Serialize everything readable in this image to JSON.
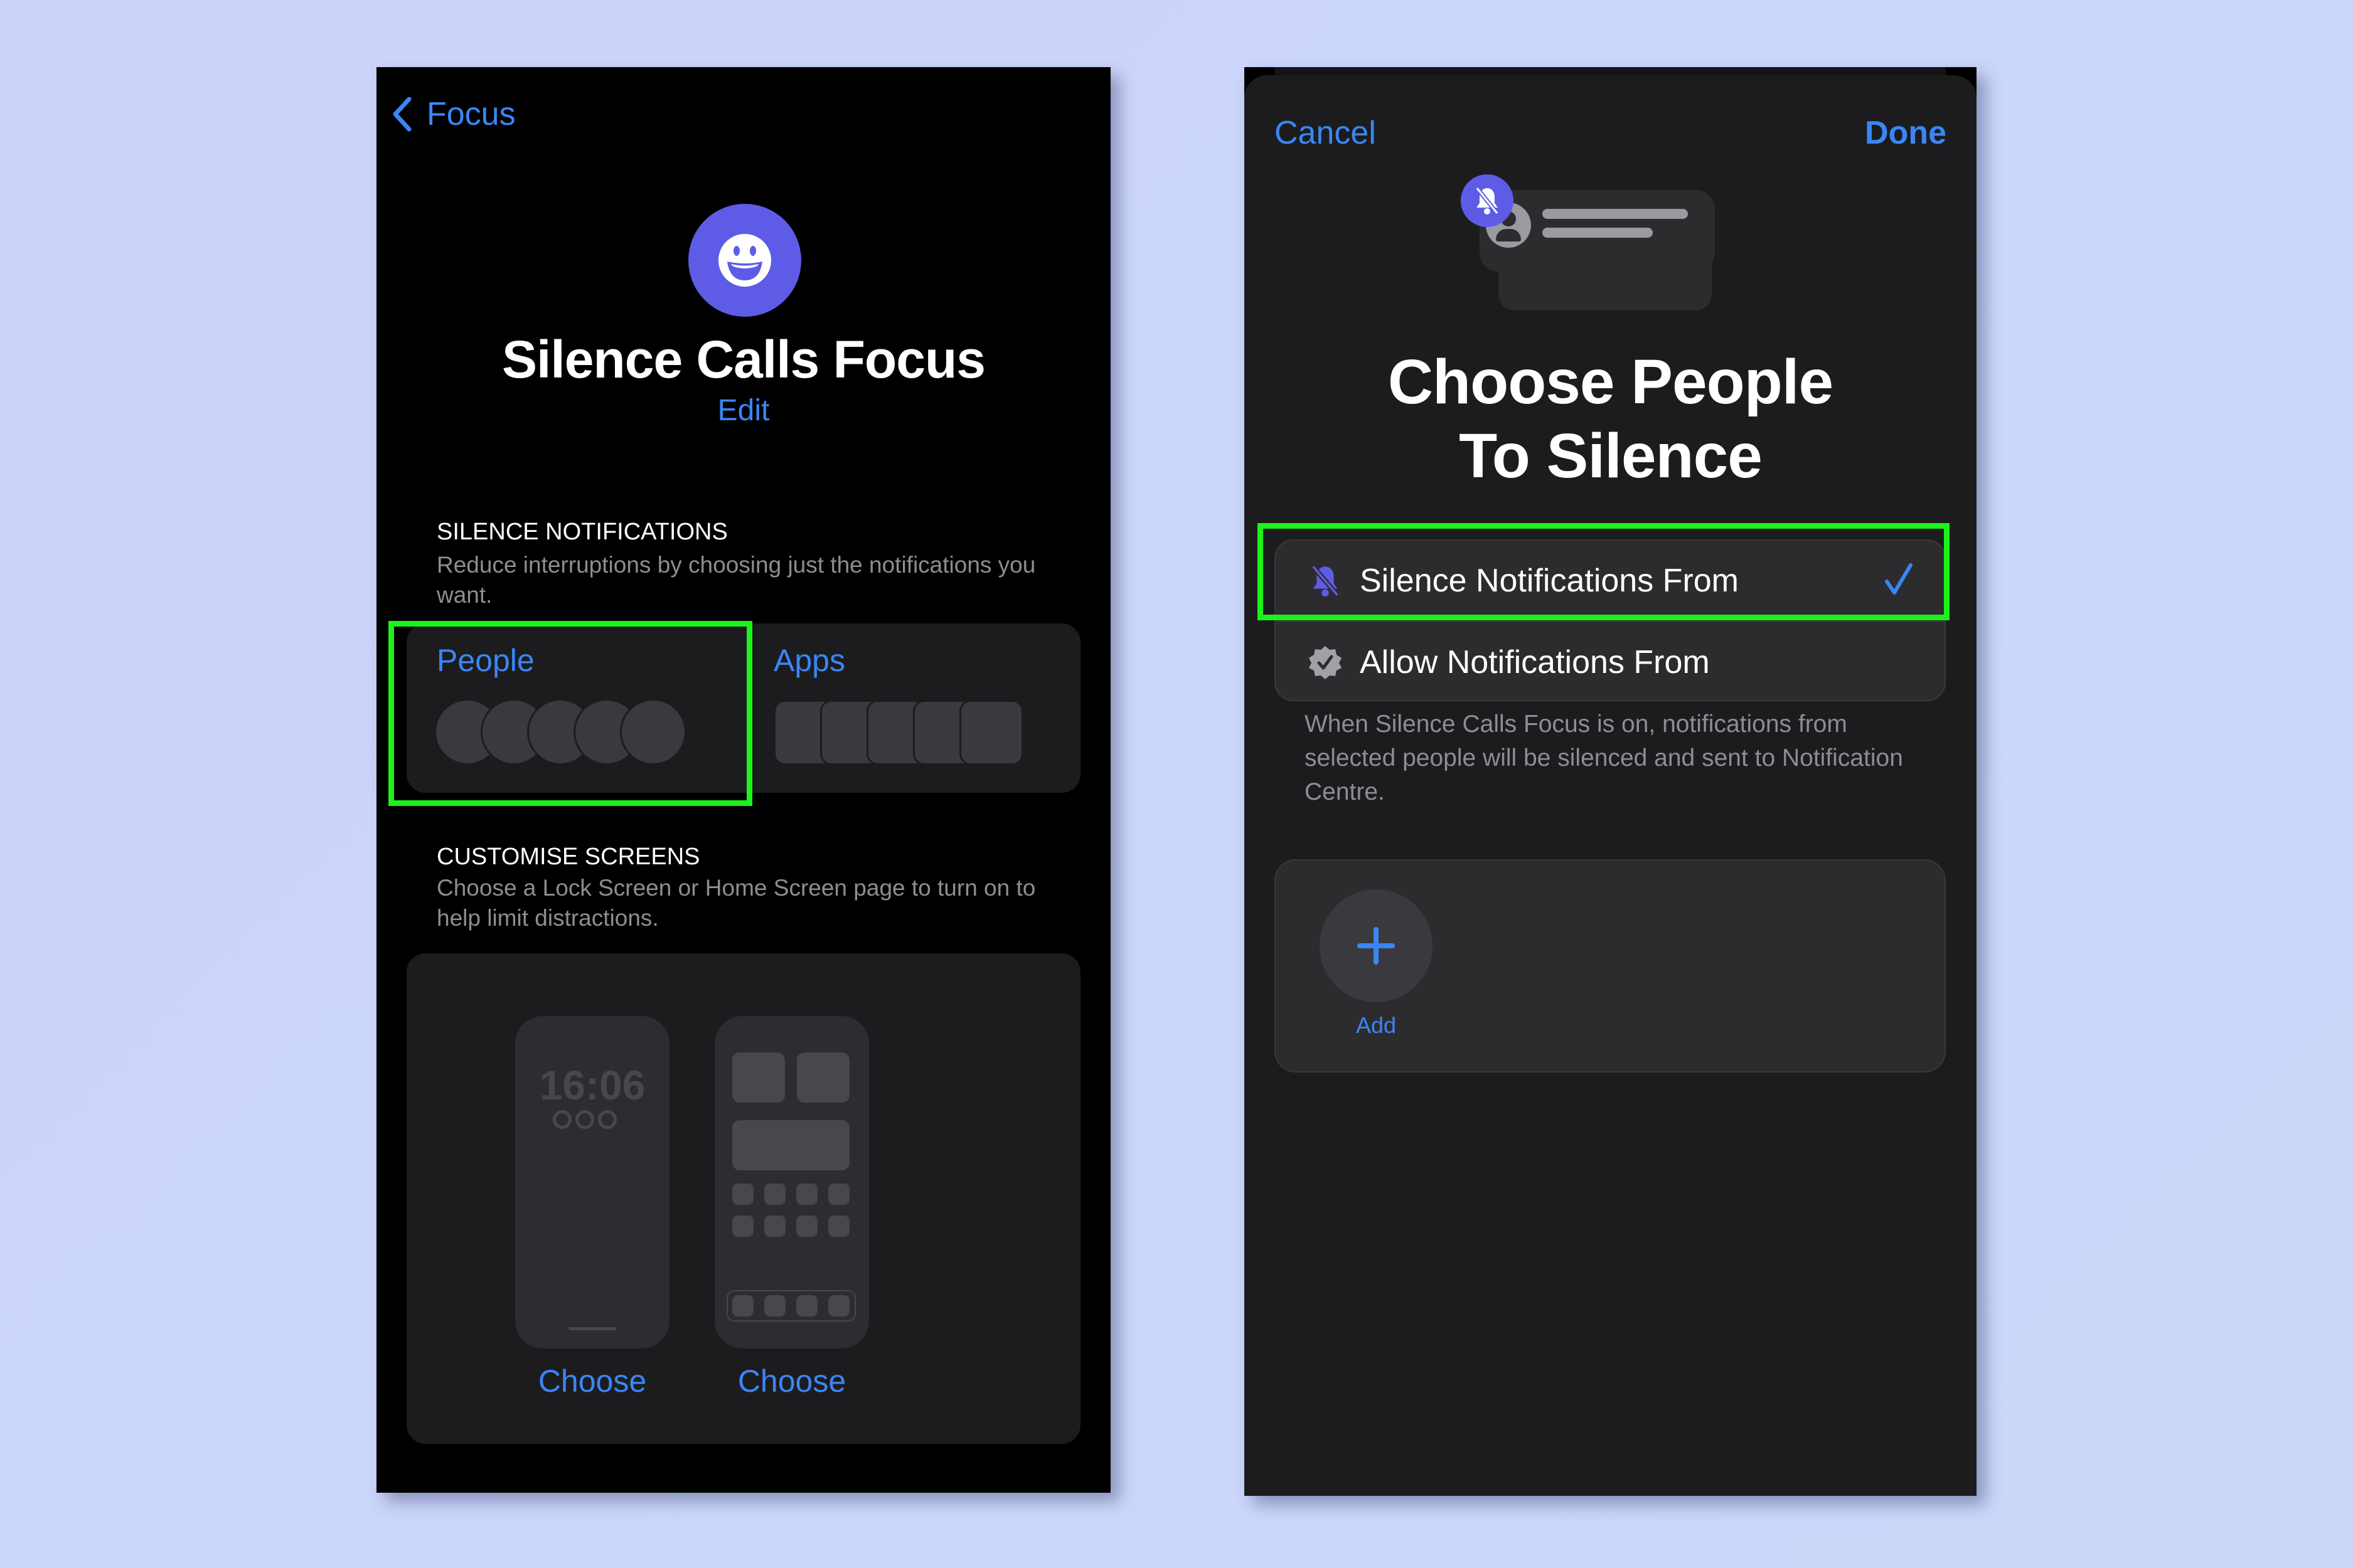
{
  "colors": {
    "accent_blue": "#3a86f5",
    "focus_purple": "#5e5ce6",
    "highlight_green": "#1cf21c",
    "background": "#ccd6fb"
  },
  "left_screen": {
    "back_label": "Focus",
    "focus_icon": "smiley-face-icon",
    "title": "Silence Calls Focus",
    "edit_label": "Edit",
    "silence_section": {
      "heading": "SILENCE NOTIFICATIONS",
      "description": "Reduce interruptions by choosing just the notifications you want.",
      "people_label": "People",
      "apps_label": "Apps",
      "people_placeholder_count": 5,
      "apps_placeholder_count": 5
    },
    "customise_section": {
      "heading": "CUSTOMISE SCREENS",
      "description": "Choose a Lock Screen or Home Screen page to turn on to help limit distractions.",
      "lock_screen_time": "16:06",
      "lock_choose_label": "Choose",
      "home_choose_label": "Choose"
    }
  },
  "right_screen": {
    "cancel_label": "Cancel",
    "done_label": "Done",
    "title_line1": "Choose People",
    "title_line2": "To Silence",
    "options": [
      {
        "label": "Silence Notifications From",
        "icon": "bell-slash-icon",
        "selected": true
      },
      {
        "label": "Allow Notifications From",
        "icon": "checkmark-seal-icon",
        "selected": false
      }
    ],
    "footer_text": "When Silence Calls Focus is on, notifications from selected people will be silenced and sent to Notification Centre.",
    "add_label": "Add"
  }
}
